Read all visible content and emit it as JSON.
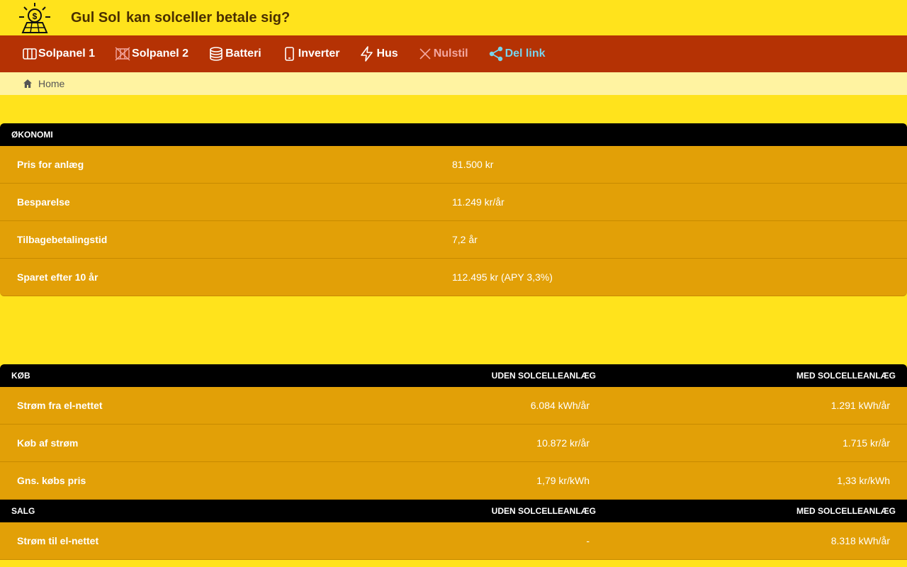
{
  "header": {
    "brand": "Gul Sol",
    "title": "kan solceller betale sig?"
  },
  "nav": {
    "items": [
      {
        "label": "Solpanel 1",
        "icon": "solar-panel-icon"
      },
      {
        "label": "Solpanel 2",
        "icon": "solar-panel-disabled-icon"
      },
      {
        "label": "Batteri",
        "icon": "battery-stack-icon"
      },
      {
        "label": "Inverter",
        "icon": "inverter-device-icon"
      },
      {
        "label": "Hus",
        "icon": "lightning-icon"
      },
      {
        "label": "Nulstil",
        "icon": "close-icon"
      },
      {
        "label": "Del link",
        "icon": "share-icon"
      }
    ]
  },
  "breadcrumb": {
    "home": "Home"
  },
  "economy": {
    "heading": "ØKONOMI",
    "rows": [
      {
        "label": "Pris for anlæg",
        "value": "81.500 kr"
      },
      {
        "label": "Besparelse",
        "value": "11.249 kr/år"
      },
      {
        "label": "Tilbagebetalingstid",
        "value": "7,2 år"
      },
      {
        "label": "Sparet efter 10 år",
        "value": "112.495 kr (APY 3,3%)"
      }
    ]
  },
  "buy": {
    "heading": "KØB",
    "col1": "UDEN SOLCELLEANLÆG",
    "col2": "MED SOLCELLEANLÆG",
    "rows": [
      {
        "label": "Strøm fra el-nettet",
        "without": "6.084 kWh/år",
        "with": "1.291 kWh/år"
      },
      {
        "label": "Køb af strøm",
        "without": "10.872 kr/år",
        "with": "1.715 kr/år"
      },
      {
        "label": "Gns. købs pris",
        "without": "1,79 kr/kWh",
        "with": "1,33 kr/kWh"
      }
    ]
  },
  "sale": {
    "heading": "SALG",
    "col1": "UDEN SOLCELLEANLÆG",
    "col2": "MED SOLCELLEANLÆG",
    "rows": [
      {
        "label": "Strøm til el-nettet",
        "without": "-",
        "with": "8.318 kWh/år"
      }
    ]
  },
  "colors": {
    "background": "#ffe31c",
    "navbar": "#b53204",
    "breadcrumb": "#fff3a1",
    "row": "#e2a007",
    "header_bar": "#000000"
  }
}
